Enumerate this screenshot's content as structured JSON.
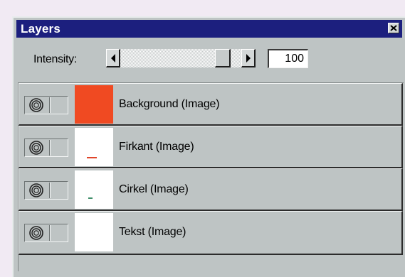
{
  "panel": {
    "title": "Layers",
    "close_icon": "close-x-icon"
  },
  "intensity": {
    "label": "Intensity:",
    "value": "100",
    "slider_fraction": 0.9,
    "left_arrow_icon": "arrow-left-icon",
    "right_arrow_icon": "arrow-right-icon"
  },
  "layers": [
    {
      "name": "Background (Image)",
      "visibility_icon": "eye-toggle-icon",
      "thumbnail_fill": "#f04a22",
      "mark_color": ""
    },
    {
      "name": "Firkant (Image)",
      "visibility_icon": "eye-toggle-icon",
      "thumbnail_fill": "#ffffff",
      "mark_color": "#e0452a"
    },
    {
      "name": "Cirkel (Image)",
      "visibility_icon": "eye-toggle-icon",
      "thumbnail_fill": "#ffffff",
      "mark_color": "#3f8f6a"
    },
    {
      "name": "Tekst (Image)",
      "visibility_icon": "eye-toggle-icon",
      "thumbnail_fill": "#ffffff",
      "mark_color": ""
    }
  ],
  "colors": {
    "titlebar": "#1c1f7e",
    "panel_bg": "#bec4c4"
  }
}
